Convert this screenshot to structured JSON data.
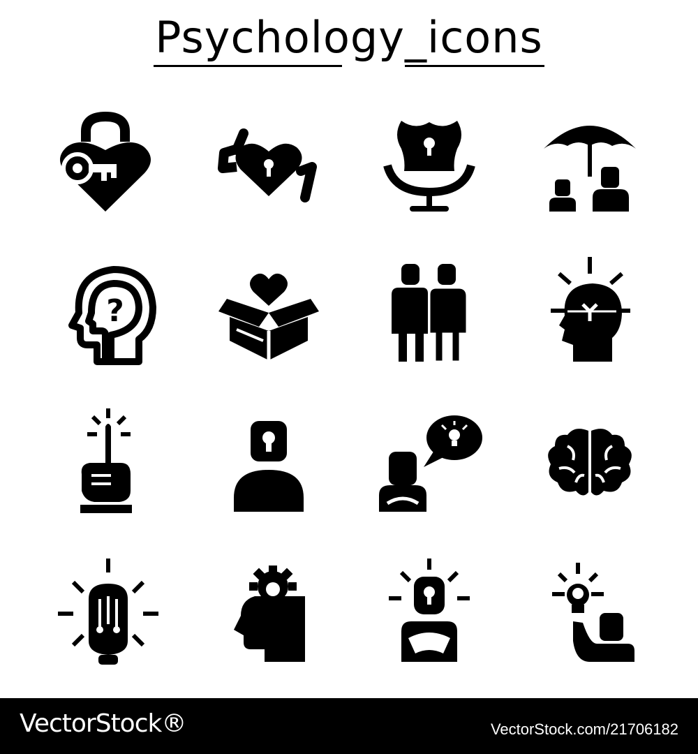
{
  "title": "Psychology_icons",
  "icons": [
    {
      "name": "heart-padlock-key-icon"
    },
    {
      "name": "heart-lock-arms-icon"
    },
    {
      "name": "armchair-keyhole-icon"
    },
    {
      "name": "umbrella-people-icon"
    },
    {
      "name": "head-question-mark-icon"
    },
    {
      "name": "open-box-heart-icon"
    },
    {
      "name": "two-people-icon"
    },
    {
      "name": "head-brain-idea-icon"
    },
    {
      "name": "finger-raised-idea-icon"
    },
    {
      "name": "person-keyhole-icon"
    },
    {
      "name": "person-speech-bulb-icon"
    },
    {
      "name": "brain-icon"
    },
    {
      "name": "lightbulb-circuit-icon"
    },
    {
      "name": "head-gear-icon"
    },
    {
      "name": "person-keyhole-rays-icon"
    },
    {
      "name": "person-raise-bulb-icon"
    }
  ],
  "footer": {
    "brand": "VectorStock®",
    "image_id": "VectorStock.com/21706182"
  },
  "colors": {
    "icon": "#000000",
    "background": "#ffffff",
    "footer_bg": "#000000"
  }
}
